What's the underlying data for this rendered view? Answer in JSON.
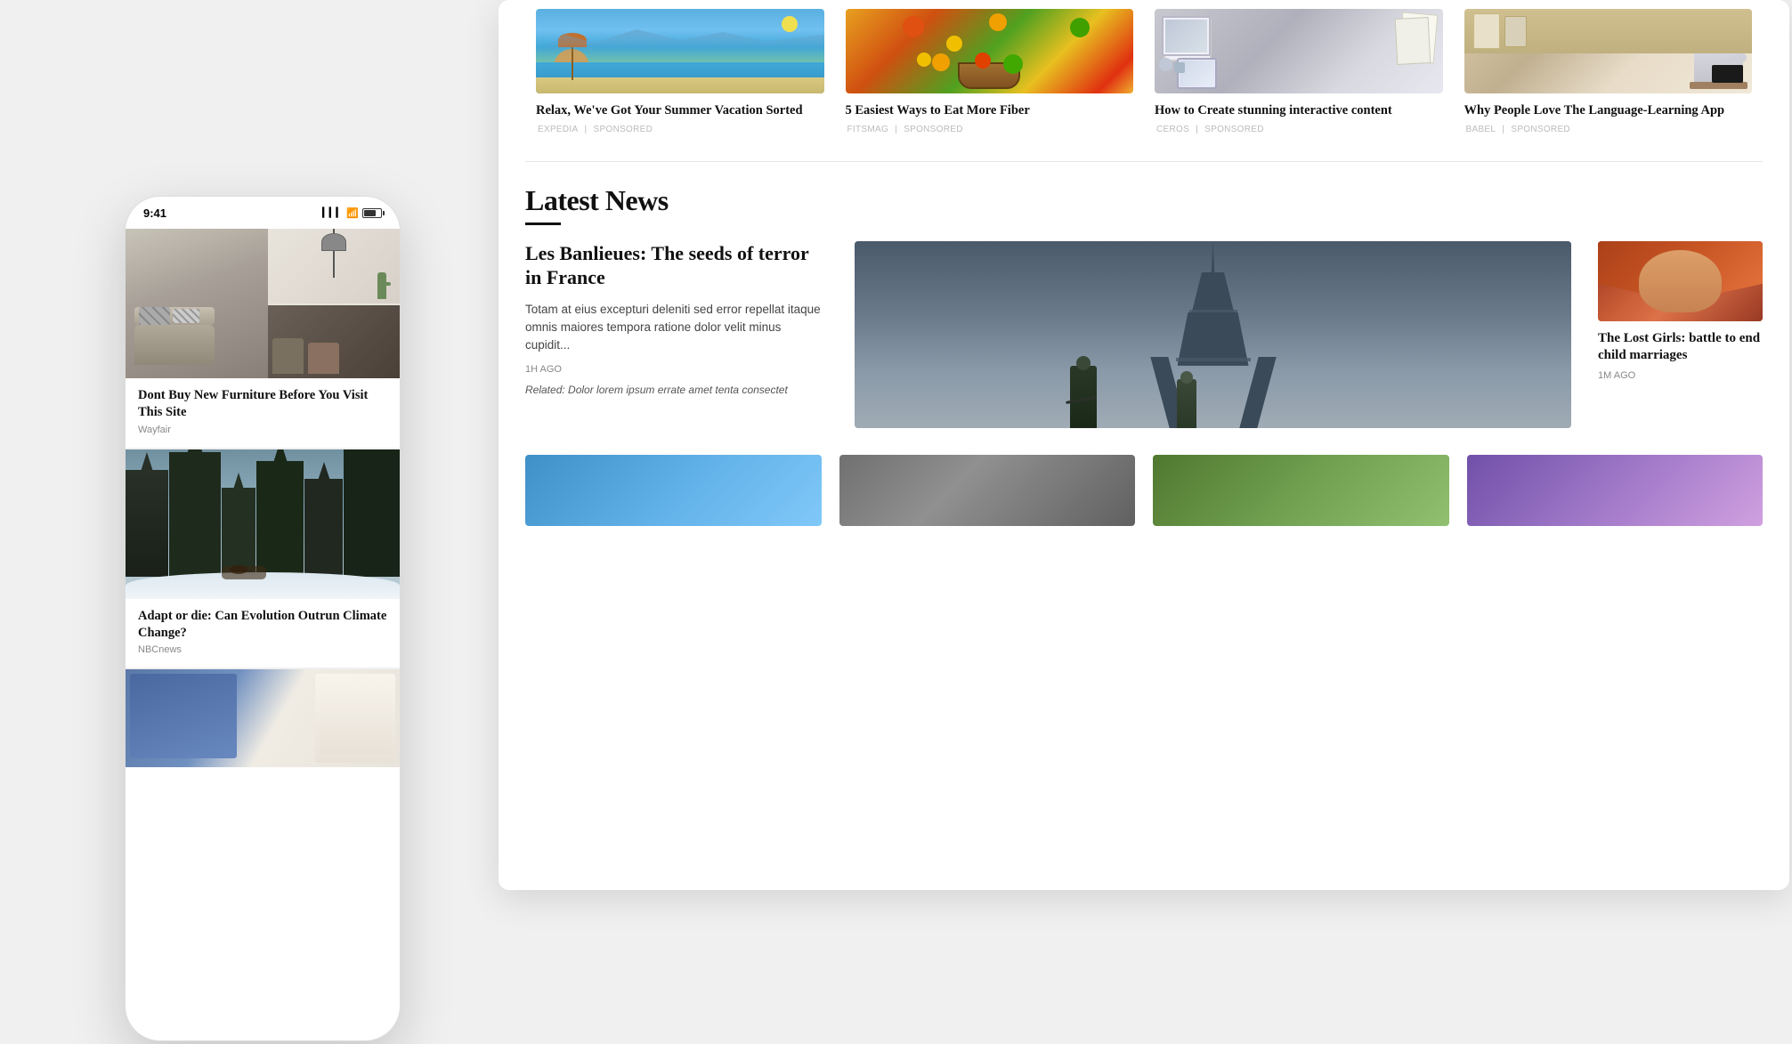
{
  "phone": {
    "time": "9:41",
    "card1": {
      "title": "Dont Buy New Furniture Before You Visit This Site",
      "source": "Wayfair"
    },
    "card2": {
      "title": "Adapt or die: Can Evolution Outrun Climate Change?",
      "source": "NBCnews"
    }
  },
  "sponsored": {
    "articles": [
      {
        "title": "Relax, We've Got Your Summer Vacation Sorted",
        "source": "EXPEDIA",
        "label": "SPONSORED"
      },
      {
        "title": "5 Easiest Ways to Eat More Fiber",
        "source": "FITSMAG",
        "label": "SPONSORED"
      },
      {
        "title": "How to Create stunning interactive content",
        "source": "CEROS",
        "label": "SPONSORED"
      },
      {
        "title": "Why People Love The Language-Learning App",
        "source": "BABEL",
        "label": "SPONSORED"
      }
    ]
  },
  "latestNews": {
    "heading": "Latest News",
    "featured": {
      "title": "Les Banlieues: The seeds of terror in France",
      "body": "Totam at eius excepturi deleniti sed error repellat itaque omnis maiores tempora ratione dolor velit minus cupidit...",
      "time": "1H AGO",
      "related": "Related: Dolor lorem ipsum errate amet tenta consectet"
    },
    "side": {
      "title": "The Lost Girls: battle to end child marriages",
      "time": "1M AGO"
    }
  }
}
